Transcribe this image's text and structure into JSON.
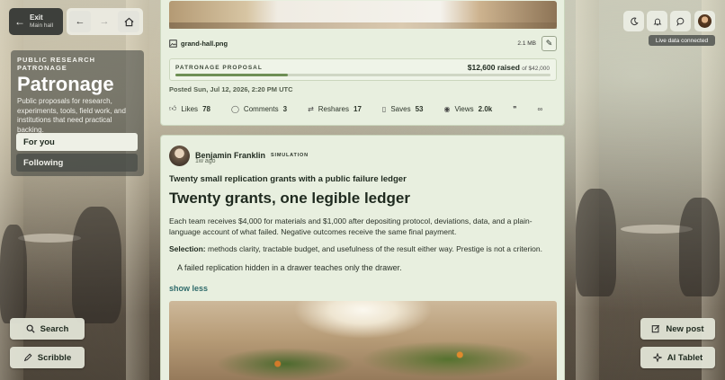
{
  "topbar": {
    "exit_label": "Exit",
    "exit_sublabel": "Main hall",
    "back_icon": "arrow-left",
    "forward_icon": "arrow-right",
    "home_icon": "home"
  },
  "sidebar": {
    "kicker": "PUBLIC RESEARCH PATRONAGE",
    "title": "Patronage",
    "description": "Public proposals for research, experiments, tools, field work, and institutions that need practical backing.",
    "tabs": [
      {
        "label": "For you",
        "active": true
      },
      {
        "label": "Following",
        "active": false
      }
    ]
  },
  "floating": {
    "search_label": "Search",
    "scribble_label": "Scribble",
    "new_post_label": "New post",
    "ai_tablet_label": "AI Tablet"
  },
  "header_right": {
    "tooltip": "Live data connected"
  },
  "post1": {
    "file_name": "grand-hall.png",
    "file_size": "2.1 MB",
    "proposal_label": "PATRONAGE PROPOSAL",
    "raised": "$12,600 raised",
    "goal": "of $42,000",
    "progress": 0.3,
    "posted": "Posted Sun, Jul 12, 2026, 2:20 PM UTC",
    "actions": {
      "likes_label": "Likes",
      "likes": "78",
      "comments_label": "Comments",
      "comments": "3",
      "reshares_label": "Reshares",
      "reshares": "17",
      "saves_label": "Saves",
      "saves": "53",
      "views_label": "Views",
      "views": "2.0k"
    }
  },
  "post2": {
    "author": "Benjamin Franklin",
    "badge": "SIMULATION",
    "time": "1w ago",
    "headline": "Twenty small replication grants with a public failure ledger",
    "title": "Twenty grants, one legible ledger",
    "body": "Each team receives $4,000 for materials and $1,000 after depositing protocol, deviations, data, and a plain-language account of what failed. Negative outcomes receive the same final payment.",
    "selection_label": "Selection:",
    "selection_text": "methods clarity, tractable budget, and usefulness of the result either way. Prestige is not a criterion.",
    "quote": "A failed replication hidden in a drawer teaches only the drawer.",
    "show_less": "show less"
  },
  "colors": {
    "accent": "#2f6b6b",
    "card_bg": "#e8efdf",
    "progress_fill": "#6e8f55"
  }
}
